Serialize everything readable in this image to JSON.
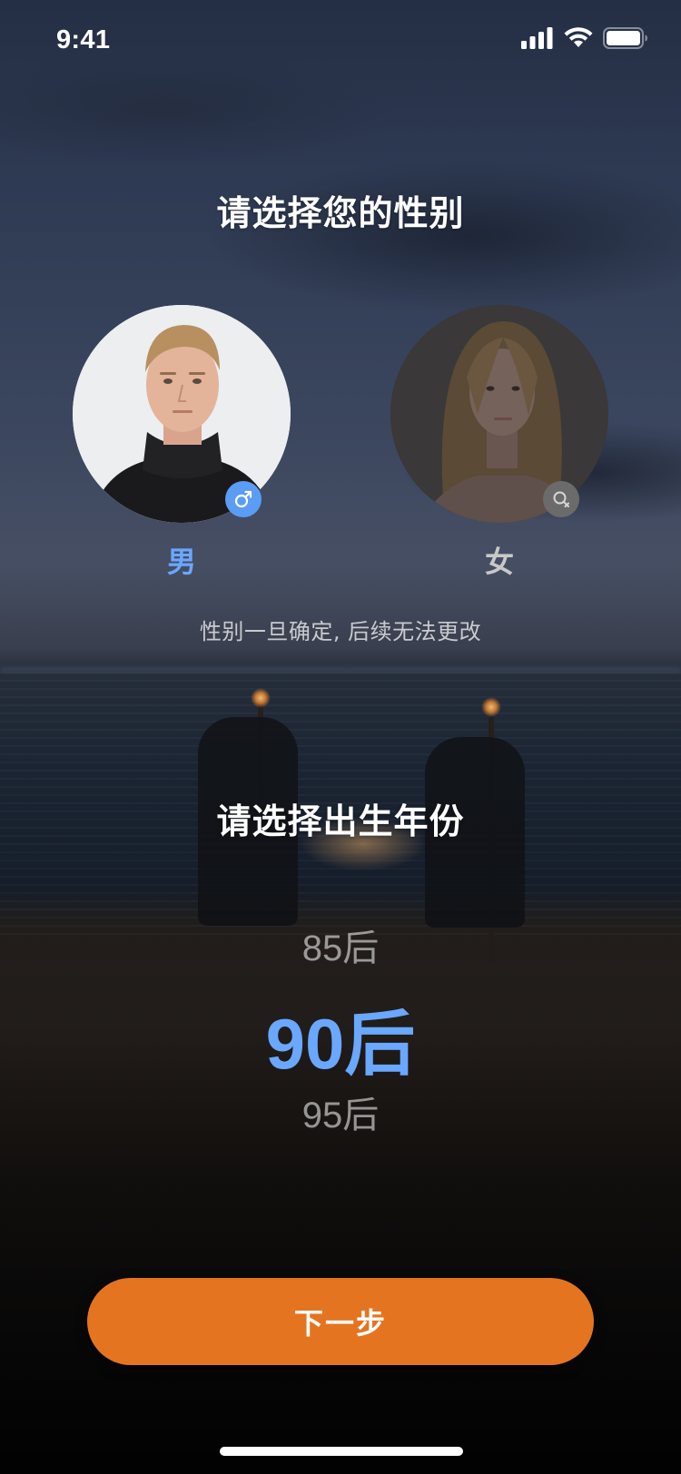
{
  "status_bar": {
    "time": "9:41",
    "signal_icon": "cellular-signal-icon",
    "wifi_icon": "wifi-icon",
    "battery_icon": "battery-icon"
  },
  "gender_section": {
    "title": "请选择您的性别",
    "options": [
      {
        "label": "男",
        "selected": true,
        "badge_icon": "male-symbol-icon",
        "label_color": "#6aa7ff",
        "badge_color": "#5b9cf5"
      },
      {
        "label": "女",
        "selected": false,
        "badge_icon": "female-symbol-icon",
        "label_color": "#c8c8c8",
        "badge_color": "#6b6b6b"
      }
    ],
    "hint": "性别一旦确定, 后续无法更改"
  },
  "birth_year_section": {
    "title": "请选择出生年份",
    "options": [
      "85后",
      "90后",
      "95后"
    ],
    "selected": "90后",
    "selected_color": "#6aa7ff"
  },
  "next_button": {
    "label": "下一步",
    "color": "#e57421"
  }
}
